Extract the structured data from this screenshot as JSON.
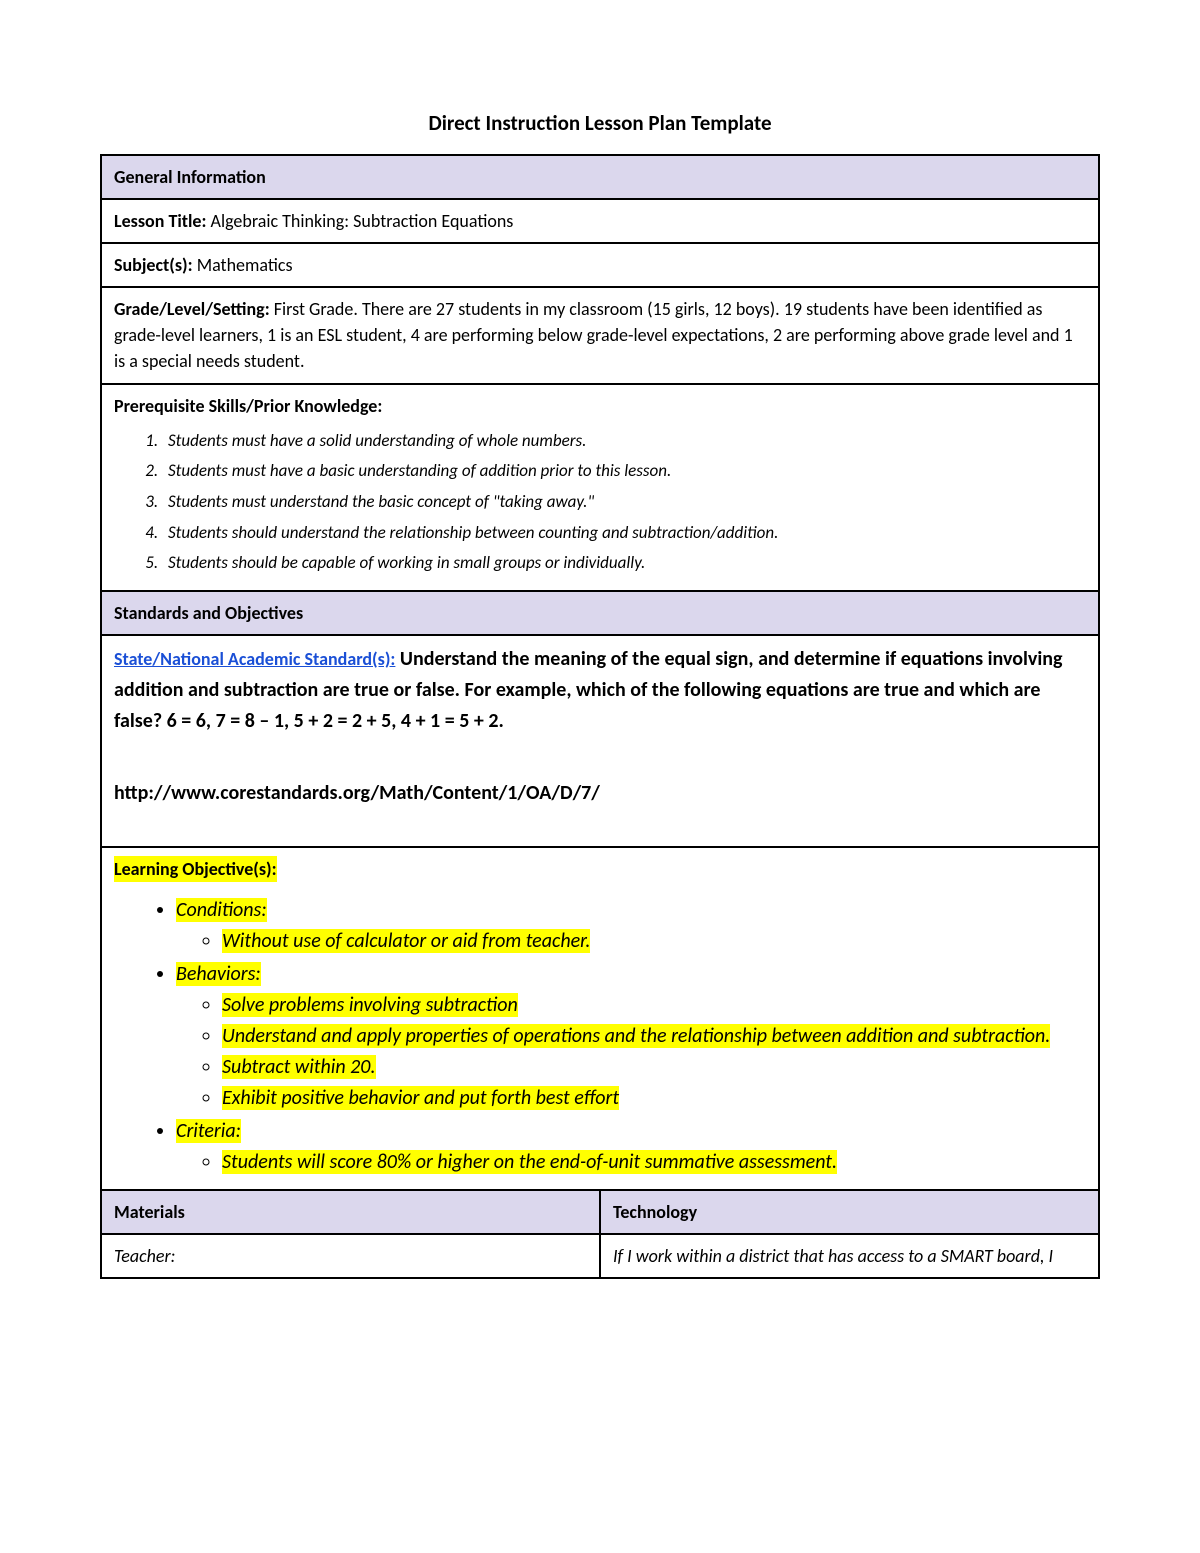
{
  "title": "Direct Instruction Lesson Plan Template",
  "sections": {
    "general": {
      "header": "General Information",
      "lessonTitleLabel": "Lesson Title:",
      "lessonTitle": " Algebraic Thinking: Subtraction Equations",
      "subjectLabel": "Subject(s):",
      "subject": " Mathematics",
      "gradeLabel": "Grade/Level/Setting:",
      "gradeBody": " First Grade. There are 27 students in my classroom (15 girls, 12 boys). 19 students have been identified as grade-level learners, 1 is an ESL student, 4 are performing below grade-level expectations, 2 are performing above grade level and 1 is a special needs student.",
      "prereqLabel": "Prerequisite Skills/Prior Knowledge:",
      "prereqs": [
        "Students must have a solid understanding of whole numbers.",
        "Students must have a basic understanding of addition prior to this lesson.",
        "Students must understand the basic concept of \"taking away.\"",
        "Students should understand the relationship between counting and subtraction/addition.",
        "Students should be capable of working in small groups or individually."
      ]
    },
    "standards": {
      "header": "Standards and Objectives",
      "linkText": "State/National Academic Standard(s):",
      "body": " Understand the meaning of the equal sign, and determine if equations involving addition and subtraction are true or false. For example, which of the following equations are true and which are false? 6 = 6, 7 = 8 – 1, 5 + 2 = 2 + 5, 4 + 1 = 5 + 2.",
      "url": "http://www.corestandards.org/Math/Content/1/OA/D/7/",
      "loHeader": "Learning Objective(s):",
      "objectives": [
        {
          "label": "Conditions:",
          "items": [
            "Without use of calculator or aid from teacher."
          ]
        },
        {
          "label": "Behaviors:",
          "items": [
            "Solve problems involving subtraction",
            "Understand and apply properties of operations and the relationship between addition and subtraction.",
            "Subtract within 20.",
            "Exhibit positive behavior and put forth best effort"
          ]
        },
        {
          "label": "Criteria:",
          "items": [
            "Students will score 80% or higher on the end-of-unit summative assessment."
          ]
        }
      ]
    },
    "materials": {
      "headerLeft": "Materials",
      "headerRight": "Technology",
      "teacherLabel": "Teacher:",
      "techBody": "If I work within a district that has access to a SMART board, I"
    }
  }
}
